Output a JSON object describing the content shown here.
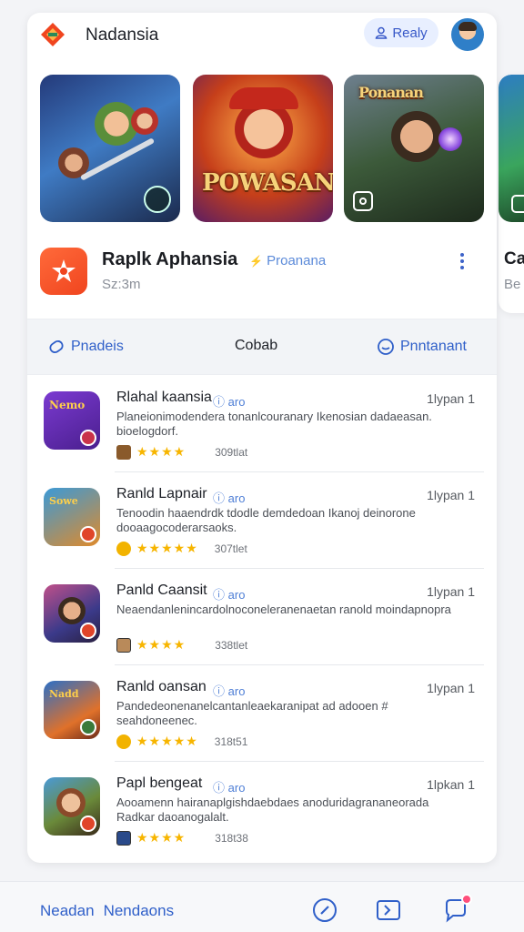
{
  "header": {
    "title": "Nadansia",
    "ready_label": "Realy"
  },
  "carousel": [
    {
      "art_title": ""
    },
    {
      "art_title": "POWASAN"
    },
    {
      "art_title": "Ponanan"
    }
  ],
  "peek": {
    "title": "Ca",
    "sub": "Be"
  },
  "feature": {
    "title": "Raplk Aphansia",
    "tag": "Proanana",
    "sub": "Sz:3m"
  },
  "tabs": [
    {
      "label": "Pnadeis"
    },
    {
      "label": "Cobab"
    },
    {
      "label": "Pnntanant"
    }
  ],
  "list": [
    {
      "title": "Rlahal kaansia",
      "tag": "aro",
      "time": "1lypan 1",
      "desc": "Planeionimodendera tonanlcouranary Ikenosian dadaeasan. bioelogdorf.",
      "count": "309tlat",
      "stars": "★★★★"
    },
    {
      "title": "Ranld Lapnair",
      "tag": "aro",
      "time": "1lypan 1",
      "desc": "Tenoodin haaendrdk tdodle demdedoan Ikanoj deinorone dooaagocoderarsaoks.",
      "count": "307tlet",
      "stars": "★★★★★"
    },
    {
      "title": "Panld Caansit",
      "tag": "aro",
      "time": "1lypan 1",
      "desc": "Neaendanlenincardolnoconeleranenaetan ranold moindapnopra",
      "count": "338tlet",
      "stars": "★★★★"
    },
    {
      "title": "Ranld oansan",
      "tag": "aro",
      "time": "1lypan 1",
      "desc": "Pandedeonenanelcantanleaekaranipat ad adooen # seahdoneenec.",
      "count": "318t51",
      "stars": "★★★★★"
    },
    {
      "title": "Papl bengeat",
      "tag": "aro",
      "time": "1lpkan 1",
      "desc": "Aooamenn hairanaplgishdaebdaes anoduridagrananeorada Radkar daoanogalalt.",
      "count": "318t38",
      "stars": "★★★★"
    }
  ],
  "bottom": {
    "left_a": "Neadan",
    "left_b": "Nendaons"
  },
  "colors": {
    "accent": "#2f5fc9",
    "orange": "#f0451f",
    "star": "#f7b500"
  }
}
